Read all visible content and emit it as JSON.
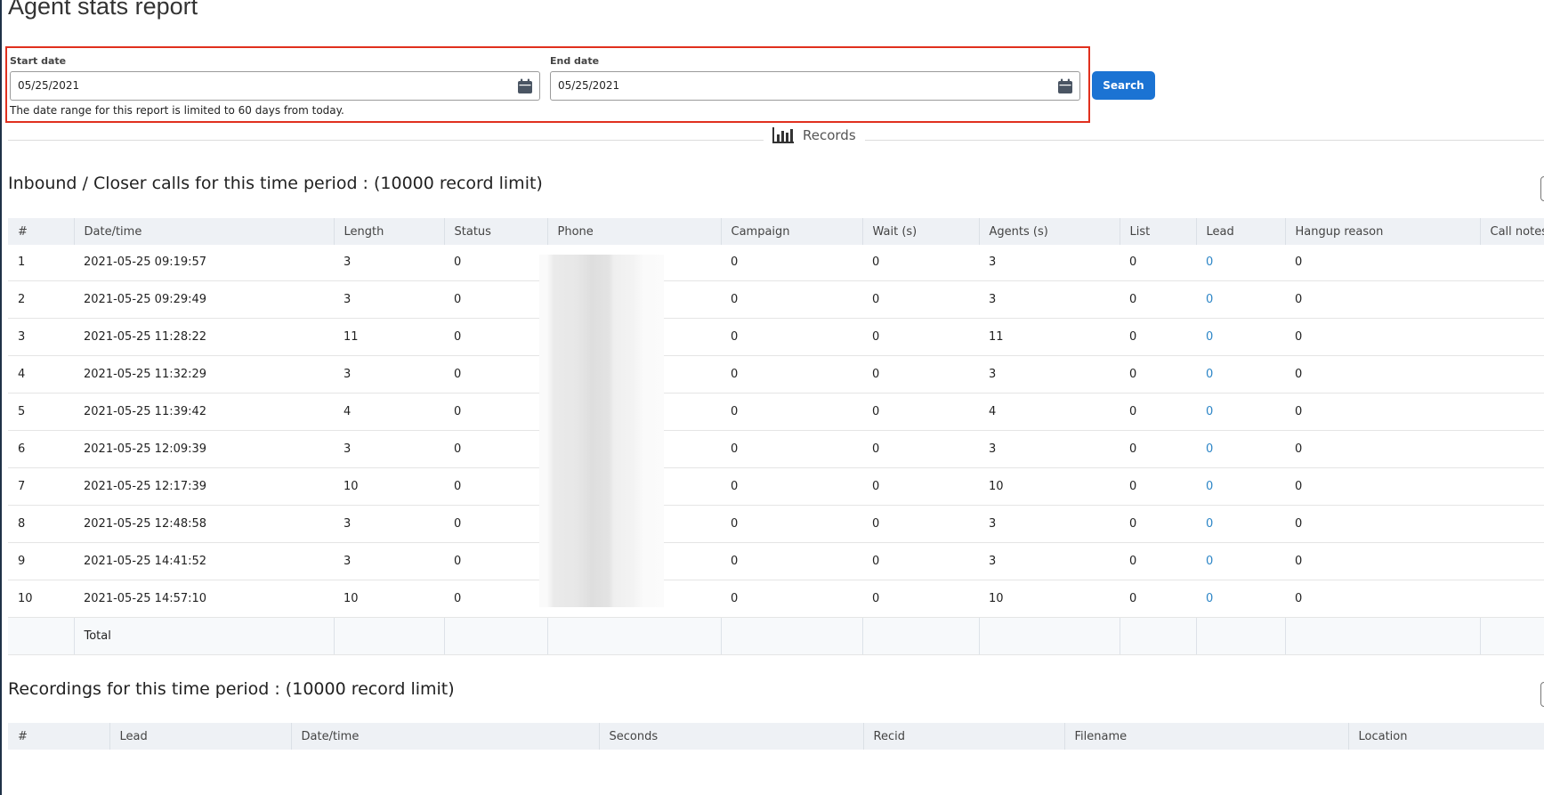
{
  "page": {
    "title": "Agent stats report"
  },
  "filters": {
    "start_date_label": "Start date",
    "start_date_value": "05/25/2021",
    "end_date_label": "End date",
    "end_date_value": "05/25/2021",
    "range_note": "The date range for this report is limited to 60 days from today.",
    "search_label": "Search",
    "highlight_color": "#e0301e",
    "button_color": "#1b73d3",
    "icons": [
      "calendar-icon",
      "bar-chart-icon"
    ]
  },
  "records_divider": {
    "label": "Records"
  },
  "calls": {
    "title": "Inbound / Closer calls for this time period : (10000 record limit)",
    "columns": [
      "#",
      "Date/time",
      "Length",
      "Status",
      "Phone",
      "Campaign",
      "Wait (s)",
      "Agents (s)",
      "List",
      "Lead",
      "Hangup reason",
      "Call notes"
    ],
    "rows": [
      [
        "1",
        "2021-05-25 09:19:57",
        "3",
        "0",
        "",
        "0",
        "0",
        "3",
        "0",
        "0",
        "0",
        ""
      ],
      [
        "2",
        "2021-05-25 09:29:49",
        "3",
        "0",
        "",
        "0",
        "0",
        "3",
        "0",
        "0",
        "0",
        ""
      ],
      [
        "3",
        "2021-05-25 11:28:22",
        "11",
        "0",
        "",
        "0",
        "0",
        "11",
        "0",
        "0",
        "0",
        ""
      ],
      [
        "4",
        "2021-05-25 11:32:29",
        "3",
        "0",
        "",
        "0",
        "0",
        "3",
        "0",
        "0",
        "0",
        ""
      ],
      [
        "5",
        "2021-05-25 11:39:42",
        "4",
        "0",
        "",
        "0",
        "0",
        "4",
        "0",
        "0",
        "0",
        ""
      ],
      [
        "6",
        "2021-05-25 12:09:39",
        "3",
        "0",
        "",
        "0",
        "0",
        "3",
        "0",
        "0",
        "0",
        ""
      ],
      [
        "7",
        "2021-05-25 12:17:39",
        "10",
        "0",
        "",
        "0",
        "0",
        "10",
        "0",
        "0",
        "0",
        ""
      ],
      [
        "8",
        "2021-05-25 12:48:58",
        "3",
        "0",
        "",
        "0",
        "0",
        "3",
        "0",
        "0",
        "0",
        ""
      ],
      [
        "9",
        "2021-05-25 14:41:52",
        "3",
        "0",
        "",
        "0",
        "0",
        "3",
        "0",
        "0",
        "0",
        ""
      ],
      [
        "10",
        "2021-05-25 14:57:10",
        "10",
        "0",
        "",
        "0",
        "0",
        "10",
        "0",
        "0",
        "0",
        ""
      ]
    ],
    "total_label": "Total",
    "link_color": "#2d86c7"
  },
  "recordings": {
    "title": "Recordings for this time period : (10000 record limit)",
    "columns": [
      "#",
      "Lead",
      "Date/time",
      "Seconds",
      "Recid",
      "Filename",
      "Location"
    ]
  }
}
